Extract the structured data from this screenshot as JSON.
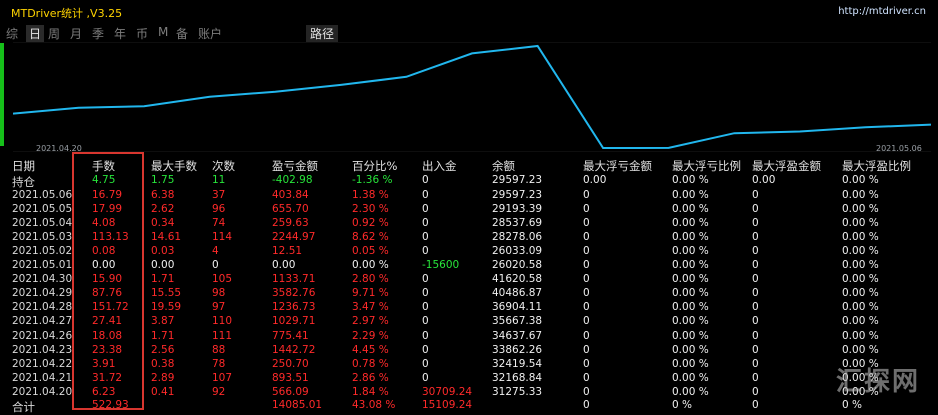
{
  "header": {
    "title": "MTDriver统计 ,V3.25",
    "url": "http://mtdriver.cn"
  },
  "tabs": [
    "综",
    "日",
    "周",
    "月",
    "季",
    "年",
    "币",
    "M",
    "备",
    "账户",
    "路径"
  ],
  "tab_active": "日",
  "chart_data": {
    "type": "line",
    "x": [
      "2021.04.20",
      "2021.04.21",
      "2021.04.22",
      "2021.04.23",
      "2021.04.26",
      "2021.04.27",
      "2021.04.28",
      "2021.04.29",
      "2021.04.30",
      "2021.05.01",
      "2021.05.02",
      "2021.05.03",
      "2021.05.04",
      "2021.05.05",
      "2021.05.06"
    ],
    "values": [
      31275.33,
      32168.84,
      32419.54,
      33862.26,
      34637.67,
      35667.38,
      36904.11,
      40486.87,
      41620.58,
      26020.58,
      26033.09,
      28278.06,
      28537.69,
      29193.39,
      29597.23
    ],
    "xlabel_start": "2021.04.20",
    "xlabel_end": "2021.05.06",
    "color": "#21b7ee"
  },
  "table": {
    "headers": [
      "日期",
      "手数",
      "最大手数",
      "次数",
      "盈亏金额",
      "百分比%",
      "出入金",
      "余额",
      "最大浮亏金额",
      "最大浮亏比例",
      "最大浮盈金额",
      "最大浮盈比例"
    ],
    "holding": [
      "持仓",
      "4.75",
      "1.75",
      "11",
      "-402.98",
      "-1.36 %",
      "0",
      "29597.23",
      "0.00",
      "0.00 %",
      "0.00",
      "0.00 %"
    ],
    "rows": [
      [
        "2021.05.06",
        "16.79",
        "6.38",
        "37",
        "403.84",
        "1.38 %",
        "0",
        "29597.23",
        "0",
        "0.00 %",
        "0",
        "0.00 %"
      ],
      [
        "2021.05.05",
        "17.99",
        "2.62",
        "96",
        "655.70",
        "2.30 %",
        "0",
        "29193.39",
        "0",
        "0.00 %",
        "0",
        "0.00 %"
      ],
      [
        "2021.05.04",
        "4.08",
        "0.34",
        "74",
        "259.63",
        "0.92 %",
        "0",
        "28537.69",
        "0",
        "0.00 %",
        "0",
        "0.00 %"
      ],
      [
        "2021.05.03",
        "113.13",
        "14.61",
        "114",
        "2244.97",
        "8.62 %",
        "0",
        "28278.06",
        "0",
        "0.00 %",
        "0",
        "0.00 %"
      ],
      [
        "2021.05.02",
        "0.08",
        "0.03",
        "4",
        "12.51",
        "0.05 %",
        "0",
        "26033.09",
        "0",
        "0.00 %",
        "0",
        "0.00 %"
      ],
      [
        "2021.05.01",
        "0.00",
        "0.00",
        "0",
        "0.00",
        "0.00 %",
        "-15600",
        "26020.58",
        "0",
        "0.00 %",
        "0",
        "0.00 %"
      ],
      [
        "2021.04.30",
        "15.90",
        "1.71",
        "105",
        "1133.71",
        "2.80 %",
        "0",
        "41620.58",
        "0",
        "0.00 %",
        "0",
        "0.00 %"
      ],
      [
        "2021.04.29",
        "87.76",
        "15.55",
        "98",
        "3582.76",
        "9.71 %",
        "0",
        "40486.87",
        "0",
        "0.00 %",
        "0",
        "0.00 %"
      ],
      [
        "2021.04.28",
        "151.72",
        "19.59",
        "97",
        "1236.73",
        "3.47 %",
        "0",
        "36904.11",
        "0",
        "0.00 %",
        "0",
        "0.00 %"
      ],
      [
        "2021.04.27",
        "27.41",
        "3.87",
        "110",
        "1029.71",
        "2.97 %",
        "0",
        "35667.38",
        "0",
        "0.00 %",
        "0",
        "0.00 %"
      ],
      [
        "2021.04.26",
        "18.08",
        "1.71",
        "111",
        "775.41",
        "2.29 %",
        "0",
        "34637.67",
        "0",
        "0.00 %",
        "0",
        "0.00 %"
      ],
      [
        "2021.04.23",
        "23.38",
        "2.56",
        "88",
        "1442.72",
        "4.45 %",
        "0",
        "33862.26",
        "0",
        "0.00 %",
        "0",
        "0.00 %"
      ],
      [
        "2021.04.22",
        "3.91",
        "0.38",
        "78",
        "250.70",
        "0.78 %",
        "0",
        "32419.54",
        "0",
        "0.00 %",
        "0",
        "0.00 %"
      ],
      [
        "2021.04.21",
        "31.72",
        "2.89",
        "107",
        "893.51",
        "2.86 %",
        "0",
        "32168.84",
        "0",
        "0.00 %",
        "0",
        "0.00 %"
      ],
      [
        "2021.04.20",
        "6.23",
        "0.41",
        "92",
        "566.09",
        "1.84 %",
        "30709.24",
        "31275.33",
        "0",
        "0.00 %",
        "0",
        "0.00 %"
      ]
    ],
    "total": [
      "合计",
      "522.93",
      "",
      "",
      "14085.01",
      "43.08 %",
      "15109.24",
      "",
      "0",
      "0 %",
      "0",
      "0 %"
    ]
  },
  "watermark": "汇探网",
  "colors": {
    "profit": "#ff2a2a",
    "holding": "#27e43a",
    "line": "#21b7ee",
    "highlight": "#d8362f"
  }
}
